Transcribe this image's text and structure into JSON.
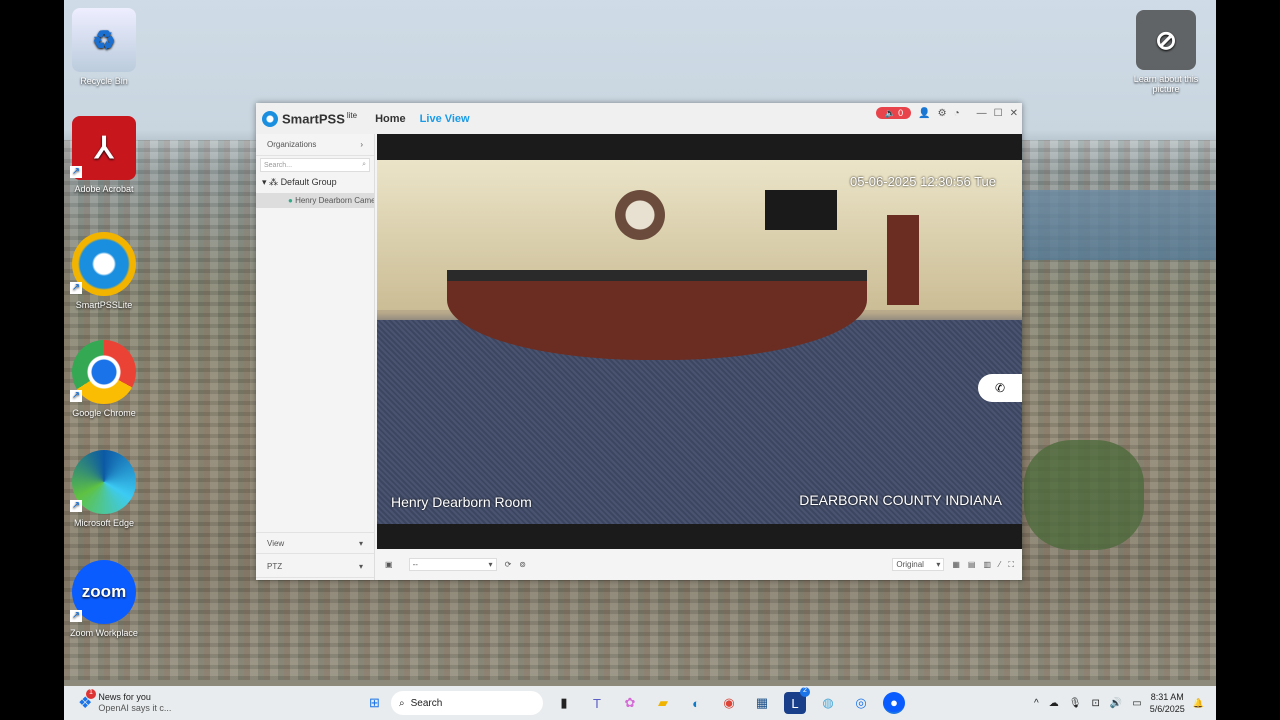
{
  "desktop": {
    "icons": [
      {
        "label": "Recycle Bin",
        "icon": "recycle-bin-icon"
      },
      {
        "label": "Adobe Acrobat",
        "icon": "acrobat-icon"
      },
      {
        "label": "SmartPSSLite",
        "icon": "smartpss-icon"
      },
      {
        "label": "Google Chrome",
        "icon": "chrome-icon"
      },
      {
        "label": "Microsoft Edge",
        "icon": "edge-icon"
      },
      {
        "label": "Zoom Workplace",
        "icon": "zoom-icon",
        "glyph": "zoom"
      }
    ],
    "learn": "Learn about this picture"
  },
  "app": {
    "brand": "SmartPSS",
    "brand_sup": "lite",
    "tabs": [
      "Home",
      "Live View"
    ],
    "active_tab": "Live View",
    "alarm_count": "0",
    "sidebar": {
      "organizations": "Organizations",
      "search_placeholder": "Search...",
      "group": "Default Group",
      "camera": "Henry Dearborn Camera",
      "view": "View",
      "ptz": "PTZ"
    },
    "video": {
      "timestamp": "05-06-2025 12:30:56 Tue",
      "channel_name": "Henry Dearborn Room",
      "overlay": "DEARBORN COUNTY INDIANA"
    },
    "bottom": {
      "stream_select": "--",
      "aspect": "Original"
    }
  },
  "taskbar": {
    "news_title": "News for you",
    "news_sub": "OpenAI says it c...",
    "news_badge": "1",
    "search": "Search",
    "lens_badge": "2",
    "time": "8:31 AM",
    "date": "5/6/2025"
  },
  "colors": {
    "accent": "#1a9be8",
    "alarm": "#e8434b"
  }
}
